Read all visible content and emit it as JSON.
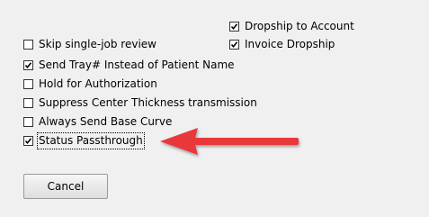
{
  "options": {
    "dropship_to_account": {
      "label": "Dropship to Account",
      "checked": true
    },
    "invoice_dropship": {
      "label": "Invoice Dropship",
      "checked": true
    },
    "skip_single_job_review": {
      "label": "Skip single-job review",
      "checked": false
    },
    "send_tray_instead_of_patient_name": {
      "label": "Send Tray# Instead of Patient Name",
      "checked": true
    },
    "hold_for_authorization": {
      "label": "Hold for Authorization",
      "checked": false
    },
    "suppress_center_thickness": {
      "label": "Suppress Center Thickness transmission",
      "checked": false
    },
    "always_send_base_curve": {
      "label": "Always Send Base Curve",
      "checked": false
    },
    "status_passthrough": {
      "label": "Status Passthrough",
      "checked": true
    }
  },
  "buttons": {
    "cancel_label": "Cancel"
  },
  "annotation": {
    "arrow_color": "#e8393a"
  }
}
